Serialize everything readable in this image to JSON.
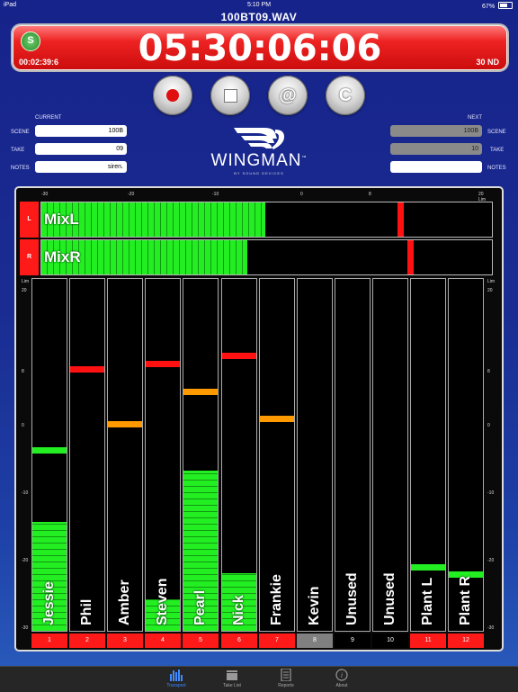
{
  "status": {
    "device": "iPad",
    "time": "5:10 PM",
    "battery": "67%",
    "battery_level": 0.67
  },
  "filename": "100BT09.WAV",
  "timecode": {
    "main": "05:30:06:06",
    "elapsed": "00:02:39:6",
    "fps": "30 ND"
  },
  "transport": {
    "record_icon": "record-icon",
    "stop_icon": "stop-icon",
    "at_glyph": "@",
    "loop_glyph": "C"
  },
  "current": {
    "header": "CURRENT",
    "scene_label": "SCENE",
    "scene": "100B",
    "take_label": "TAKE",
    "take": "09",
    "notes_label": "NOTES",
    "notes": "siren."
  },
  "next": {
    "header": "NEXT",
    "scene_label": "SCENE",
    "scene": "100B",
    "take_label": "TAKE",
    "take": "10",
    "notes_label": "NOTES",
    "notes": ""
  },
  "logo": {
    "word": "WINGMAN",
    "tm": "™",
    "by": "BY SOUND DEVICES"
  },
  "top_scale": [
    "-30",
    "-20",
    "-10",
    "0",
    "8",
    "20 Lim"
  ],
  "side_scale": [
    "Lim",
    "20",
    "8",
    "0",
    "-10",
    "-20",
    "-30"
  ],
  "mix": [
    {
      "tag": "L",
      "name": "MixL",
      "level": 0.498,
      "peak": 0.79
    },
    {
      "tag": "R",
      "name": "MixR",
      "level": 0.458,
      "peak": 0.812
    }
  ],
  "channels": [
    {
      "num": "1",
      "name": "Jessie",
      "level": 0.31,
      "peak": 0.505,
      "peak_color": "#22ee22",
      "num_bg": "#ff1a1a"
    },
    {
      "num": "2",
      "name": "Phil",
      "level": 0,
      "peak": 0.735,
      "peak_color": "#ff1111",
      "num_bg": "#ff1a1a"
    },
    {
      "num": "3",
      "name": "Amber",
      "level": 0,
      "peak": 0.578,
      "peak_color": "#ff9900",
      "num_bg": "#ff1a1a"
    },
    {
      "num": "4",
      "name": "Steven",
      "level": 0.09,
      "peak": 0.75,
      "peak_color": "#ff1111",
      "num_bg": "#ff1a1a"
    },
    {
      "num": "5",
      "name": "Pearl",
      "level": 0.455,
      "peak": 0.67,
      "peak_color": "#ff9900",
      "num_bg": "#ff1a1a"
    },
    {
      "num": "6",
      "name": "Nick",
      "level": 0.165,
      "peak": 0.773,
      "peak_color": "#ff1111",
      "num_bg": "#ff1a1a"
    },
    {
      "num": "7",
      "name": "Frankie",
      "level": 0,
      "peak": 0.593,
      "peak_color": "#ff9900",
      "num_bg": "#ff1a1a"
    },
    {
      "num": "8",
      "name": "Kevin",
      "level": 0,
      "peak": null,
      "peak_color": "",
      "num_bg": "#808080"
    },
    {
      "num": "9",
      "name": "Unused",
      "level": 0,
      "peak": null,
      "peak_color": "",
      "num_bg": "#000000"
    },
    {
      "num": "10",
      "name": "Unused",
      "level": 0,
      "peak": null,
      "peak_color": "",
      "num_bg": "#000000"
    },
    {
      "num": "11",
      "name": "Plant L",
      "level": 0,
      "peak": 0.172,
      "peak_color": "#22ee22",
      "num_bg": "#ff1a1a"
    },
    {
      "num": "12",
      "name": "Plant R",
      "level": 0,
      "peak": 0.152,
      "peak_color": "#22ee22",
      "num_bg": "#ff1a1a"
    }
  ],
  "tabs": [
    {
      "label": "Transport",
      "icon": "meter-icon",
      "active": true
    },
    {
      "label": "Take List",
      "icon": "clapper-icon",
      "active": false
    },
    {
      "label": "Reports",
      "icon": "document-icon",
      "active": false
    },
    {
      "label": "About",
      "icon": "info-icon",
      "active": false
    }
  ]
}
